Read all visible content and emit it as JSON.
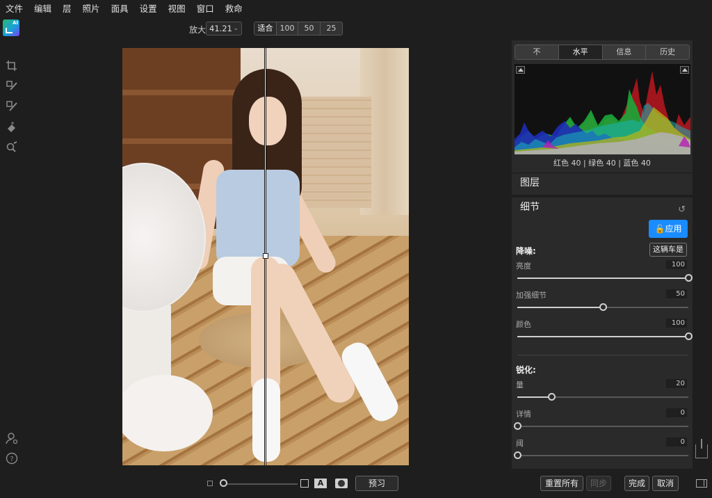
{
  "menu": [
    "文件",
    "编辑",
    "层",
    "照片",
    "面具",
    "设置",
    "视图",
    "窗口",
    "救命"
  ],
  "app_logo": {
    "text": "AI"
  },
  "toolbar": {
    "zoom_label": "放大",
    "zoom_value": "41.21",
    "zoom_presets": [
      "适合",
      "100",
      "50",
      "25"
    ],
    "active_preset": "适合"
  },
  "left_tools": [
    "crop-icon",
    "brush-mask-icon",
    "brush-erase-icon",
    "retouch-icon",
    "zoom-brush-icon"
  ],
  "left_bottom": [
    "user-icon",
    "help-icon"
  ],
  "bottom": {
    "preview_label": "预习",
    "reset_all_label": "重置所有",
    "sync_label": "同步",
    "done_label": "完成",
    "cancel_label": "取消"
  },
  "panel": {
    "tabs": [
      "不",
      "水平",
      "信息",
      "历史"
    ],
    "active_tab": "水平",
    "histogram_stats": "红色  40  | 绿色  40  | 蓝色  40",
    "layers_label": "图层",
    "detail_label": "细节",
    "apply_label": "应用",
    "noise": {
      "title": "降噪:",
      "preset_button": "这辆车是",
      "params": [
        {
          "label": "亮度",
          "value": "100",
          "level": 1.0
        },
        {
          "label": "加强细节",
          "value": "50",
          "level": 0.5
        },
        {
          "label": "颜色",
          "value": "100",
          "level": 1.0
        }
      ]
    },
    "sharpen": {
      "title": "锐化:",
      "params": [
        {
          "label": "量",
          "value": "20",
          "level": 0.2
        },
        {
          "label": "详情",
          "value": "0",
          "level": 0.0
        },
        {
          "label": "阈",
          "value": "0",
          "level": 0.0
        }
      ]
    }
  },
  "colors": {
    "accent": "#1a8cff",
    "background": "#1e1e1e",
    "panel": "#2a2a2a"
  }
}
